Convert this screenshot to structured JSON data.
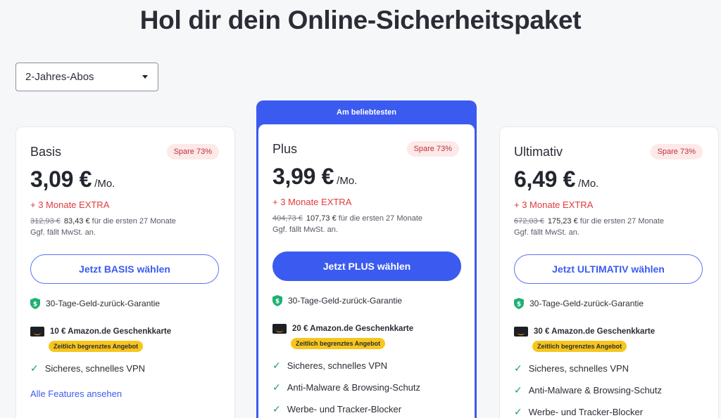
{
  "page": {
    "title": "Hol dir dein Online-Sicherheitspaket"
  },
  "term_select": {
    "value": "2-Jahres-Abos"
  },
  "colors": {
    "accent": "#3b5bf0",
    "extra_red": "#e03b3b",
    "badge_bg": "#fce9e8",
    "check_green": "#1a9b6a",
    "limited_yellow": "#f7c61d"
  },
  "plans": [
    {
      "name": "Basis",
      "badge": "Spare 73%",
      "price": "3,09 €",
      "unit": "/Mo.",
      "extra": "+ 3 Monate EXTRA",
      "old_price": "312,93 €",
      "new_total": "83,43 €",
      "period_text": "für die ersten 27 Monate",
      "vat": "Ggf. fällt MwSt. an.",
      "button": "Jetzt BASIS wählen",
      "guarantee": "30-Tage-Geld-zurück-Garantie",
      "giftcard": "10 € Amazon.de Geschenkkarte",
      "limited": "Zeitlich begrenztes Angebot",
      "features": [
        "Sicheres, schnelles VPN"
      ],
      "all_features": "Alle Features ansehen"
    },
    {
      "banner": "Am beliebtesten",
      "name": "Plus",
      "badge": "Spare 73%",
      "price": "3,99 €",
      "unit": "/Mo.",
      "extra": "+ 3 Monate EXTRA",
      "old_price": "404,73 €",
      "new_total": "107,73 €",
      "period_text": "für die ersten 27 Monate",
      "vat": "Ggf. fällt MwSt. an.",
      "button": "Jetzt PLUS wählen",
      "guarantee": "30-Tage-Geld-zurück-Garantie",
      "giftcard": "20 € Amazon.de Geschenkkarte",
      "limited": "Zeitlich begrenztes Angebot",
      "features": [
        "Sicheres, schnelles VPN",
        "Anti-Malware & Browsing-Schutz",
        "Werbe- und Tracker-Blocker"
      ]
    },
    {
      "name": "Ultimativ",
      "badge": "Spare 73%",
      "price": "6,49 €",
      "unit": "/Mo.",
      "extra": "+ 3 Monate EXTRA",
      "old_price": "672,03 €",
      "new_total": "175,23 €",
      "period_text": "für die ersten 27 Monate",
      "vat": "Ggf. fällt MwSt. an.",
      "button": "Jetzt ULTIMATIV wählen",
      "guarantee": "30-Tage-Geld-zurück-Garantie",
      "giftcard": "30 € Amazon.de Geschenkkarte",
      "limited": "Zeitlich begrenztes Angebot",
      "features": [
        "Sicheres, schnelles VPN",
        "Anti-Malware & Browsing-Schutz",
        "Werbe- und Tracker-Blocker"
      ]
    }
  ]
}
